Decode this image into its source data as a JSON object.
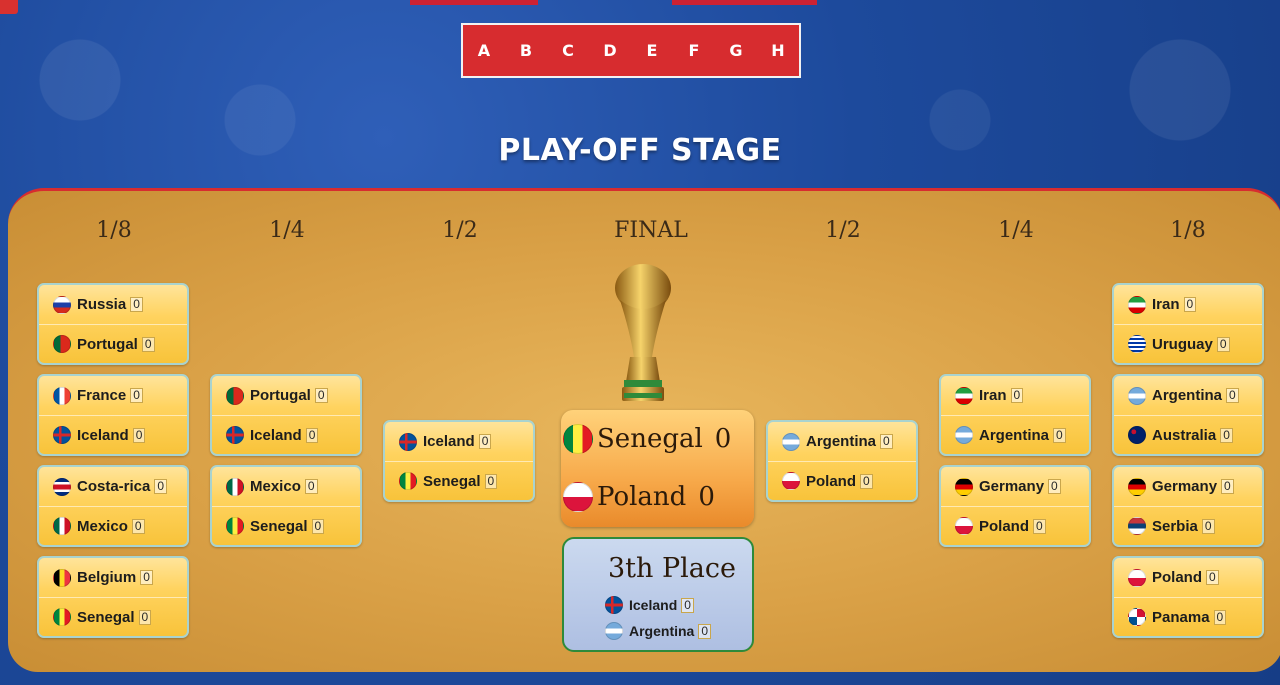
{
  "nav": {
    "groups": [
      "A",
      "B",
      "C",
      "D",
      "E",
      "F",
      "G",
      "H"
    ]
  },
  "title": "PLAY-OFF STAGE",
  "rounds": [
    "1/8",
    "1/4",
    "1/2",
    "FINAL",
    "1/2",
    "1/4",
    "1/8"
  ],
  "matches": {
    "l8_1": {
      "t1": "Russia",
      "s1": "0",
      "t2": "Portugal",
      "s2": "0"
    },
    "l8_2": {
      "t1": "France",
      "s1": "0",
      "t2": "Iceland",
      "s2": "0"
    },
    "l8_3": {
      "t1": "Costa-rica",
      "s1": "0",
      "t2": "Mexico",
      "s2": "0"
    },
    "l8_4": {
      "t1": "Belgium",
      "s1": "0",
      "t2": "Senegal",
      "s2": "0"
    },
    "l4_1": {
      "t1": "Portugal",
      "s1": "0",
      "t2": "Iceland",
      "s2": "0"
    },
    "l4_2": {
      "t1": "Mexico",
      "s1": "0",
      "t2": "Senegal",
      "s2": "0"
    },
    "l2_1": {
      "t1": "Iceland",
      "s1": "0",
      "t2": "Senegal",
      "s2": "0"
    },
    "r2_1": {
      "t1": "Argentina",
      "s1": "0",
      "t2": "Poland",
      "s2": "0"
    },
    "r4_1": {
      "t1": "Iran",
      "s1": "0",
      "t2": "Argentina",
      "s2": "0"
    },
    "r4_2": {
      "t1": "Germany",
      "s1": "0",
      "t2": "Poland",
      "s2": "0"
    },
    "r8_1": {
      "t1": "Iran",
      "s1": "0",
      "t2": "Uruguay",
      "s2": "0"
    },
    "r8_2": {
      "t1": "Argentina",
      "s1": "0",
      "t2": "Australia",
      "s2": "0"
    },
    "r8_3": {
      "t1": "Germany",
      "s1": "0",
      "t2": "Serbia",
      "s2": "0"
    },
    "r8_4": {
      "t1": "Poland",
      "s1": "0",
      "t2": "Panama",
      "s2": "0"
    }
  },
  "final": {
    "t1": "Senegal",
    "s1": "0",
    "t2": "Poland",
    "s2": "0"
  },
  "third": {
    "title": "3th Place",
    "t1": "Iceland",
    "s1": "0",
    "t2": "Argentina",
    "s2": "0"
  },
  "colors": {
    "nav": "#d72c2f",
    "board": "#e0a94f",
    "match": "#ffd35f",
    "final": "#f7a94a",
    "third": "#aebfe2"
  }
}
